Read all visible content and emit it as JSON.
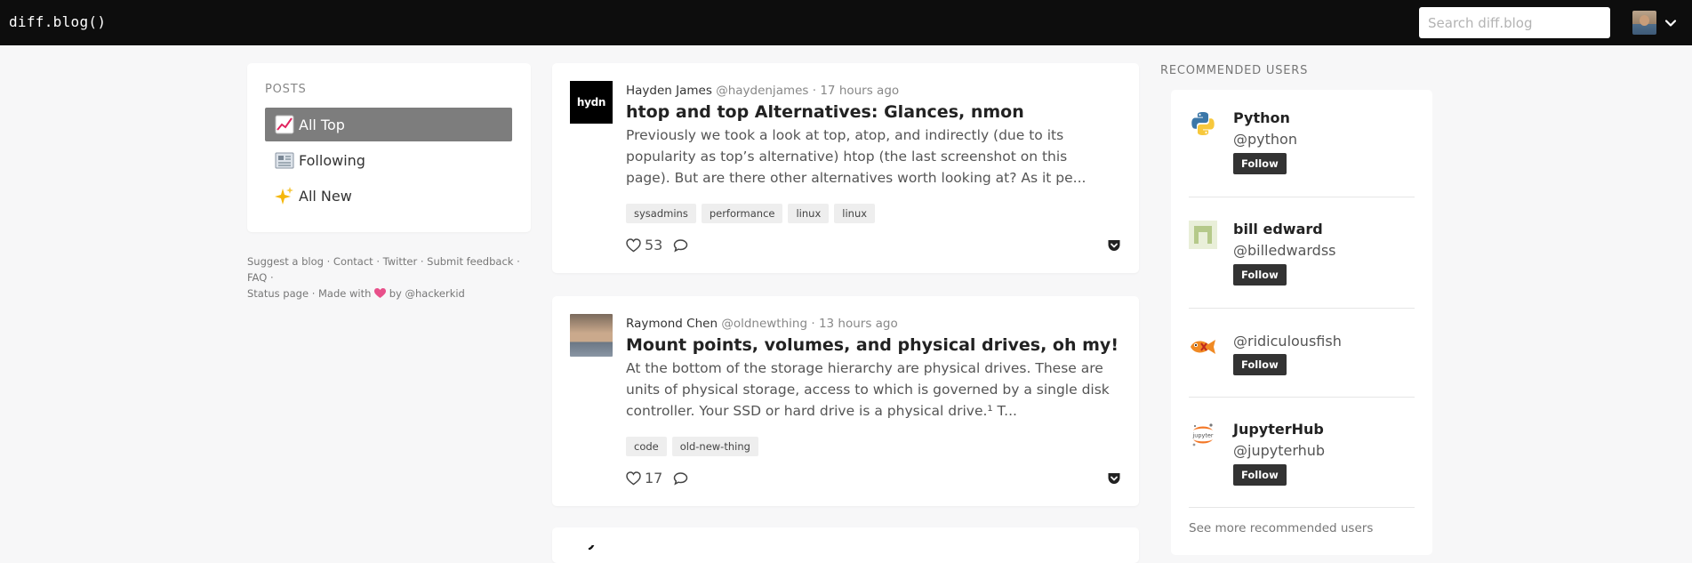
{
  "header": {
    "logo": "diff.blog()",
    "search_placeholder": "Search diff.blog"
  },
  "sidebar": {
    "heading": "POSTS",
    "items": [
      {
        "label": "All Top",
        "icon": "chart-increasing-icon",
        "active": true
      },
      {
        "label": "Following",
        "icon": "newspaper-icon",
        "active": false
      },
      {
        "label": "All New",
        "icon": "sparkles-icon",
        "active": false
      }
    ],
    "footer": {
      "suggest": "Suggest a blog",
      "contact": "Contact",
      "twitter": "Twitter",
      "feedback": "Submit feedback",
      "faq": "FAQ",
      "status": "Status page",
      "made_with": "Made with",
      "by": "by",
      "author": "@hackerkid",
      "sep": "·"
    }
  },
  "posts": [
    {
      "author": "Hayden James",
      "handle": "@haydenjames",
      "time": "17 hours ago",
      "title": "htop and top Alternatives: Glances, nmon",
      "excerpt": "Previously we took a look at top, atop, and indirectly (due to its popularity as top’s alternative) htop (the last screenshot on this page). But are there other alternatives worth looking at? As it pe...",
      "tags": [
        "sysadmins",
        "performance",
        "linux",
        "linux"
      ],
      "likes": "53",
      "avatar_text": "hydn"
    },
    {
      "author": "Raymond Chen",
      "handle": "@oldnewthing",
      "time": "13 hours ago",
      "title": "Mount points, volumes, and physical drives, oh my!",
      "excerpt": "At the bottom of the storage hierarchy are physical drives. These are units of physical storage, access to which is governed by a single disk controller. Your SSD or hard drive is a physical drive.¹ T...",
      "tags": [
        "code",
        "old-new-thing"
      ],
      "likes": "17"
    }
  ],
  "recommended": {
    "heading": "RECOMMENDED USERS",
    "follow_label": "Follow",
    "users": [
      {
        "name": "Python",
        "handle": "@python"
      },
      {
        "name": "bill edward",
        "handle": "@billedwardss"
      },
      {
        "name": "",
        "handle": "@ridiculousfish"
      },
      {
        "name": "JupyterHub",
        "handle": "@jupyterhub"
      }
    ],
    "see_more": "See more recommended users"
  },
  "colors": {
    "topbar": "#0d0d0d",
    "active_nav": "#7d7d7d",
    "follow_button": "#333333",
    "heart": "#e8508a"
  }
}
